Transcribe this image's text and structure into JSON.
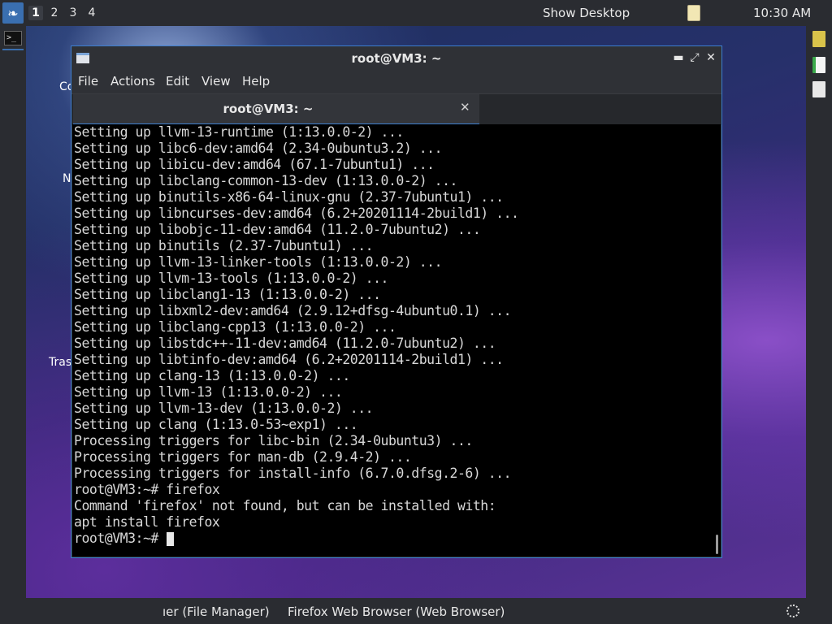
{
  "top_panel": {
    "workspaces": [
      "1",
      "2",
      "3",
      "4"
    ],
    "active_workspace": "1",
    "show_desktop": "Show Desktop",
    "clock": "10:30 AM",
    "menu_icon": "lxqt-menu-icon",
    "clipboard_icon": "clipboard-icon"
  },
  "left_panel": {
    "launcher_glyph": ">_"
  },
  "desktop": {
    "labels": [
      "Co",
      "N",
      "Tras"
    ]
  },
  "window": {
    "title": "root@VM3: ~",
    "controls": {
      "minimize": "▬",
      "maximize": "⤢",
      "close": "✕"
    },
    "menu": [
      "File",
      "Actions",
      "Edit",
      "View",
      "Help"
    ],
    "tab_label": "root@VM3: ~",
    "tab_close": "✕",
    "terminal_lines": [
      "Setting up llvm-13-runtime (1:13.0.0-2) ...",
      "Setting up libc6-dev:amd64 (2.34-0ubuntu3.2) ...",
      "Setting up libicu-dev:amd64 (67.1-7ubuntu1) ...",
      "Setting up libclang-common-13-dev (1:13.0.0-2) ...",
      "Setting up binutils-x86-64-linux-gnu (2.37-7ubuntu1) ...",
      "Setting up libncurses-dev:amd64 (6.2+20201114-2build1) ...",
      "Setting up libobjc-11-dev:amd64 (11.2.0-7ubuntu2) ...",
      "Setting up binutils (2.37-7ubuntu1) ...",
      "Setting up llvm-13-linker-tools (1:13.0.0-2) ...",
      "Setting up llvm-13-tools (1:13.0.0-2) ...",
      "Setting up libclang1-13 (1:13.0.0-2) ...",
      "Setting up libxml2-dev:amd64 (2.9.12+dfsg-4ubuntu0.1) ...",
      "Setting up libclang-cpp13 (1:13.0.0-2) ...",
      "Setting up libstdc++-11-dev:amd64 (11.2.0-7ubuntu2) ...",
      "Setting up libtinfo-dev:amd64 (6.2+20201114-2build1) ...",
      "Setting up clang-13 (1:13.0.0-2) ...",
      "Setting up llvm-13 (1:13.0.0-2) ...",
      "Setting up llvm-13-dev (1:13.0.0-2) ...",
      "Setting up clang (1:13.0-53~exp1) ...",
      "Processing triggers for libc-bin (2.34-0ubuntu3) ...",
      "Processing triggers for man-db (2.9.4-2) ...",
      "Processing triggers for install-info (6.7.0.dfsg.2-6) ...",
      "root@VM3:~# firefox",
      "Command 'firefox' not found, but can be installed with:",
      "apt install firefox"
    ],
    "prompt": "root@VM3:~# "
  },
  "right_panel": {
    "icons": [
      "qt-launcher-icon",
      "spreadsheet-icon",
      "formula-icon"
    ],
    "colors": [
      "#d9c34a",
      "#3aa84a",
      "#e8e8e8"
    ]
  },
  "bottom_panel": {
    "tasks": [
      "ıer (File Manager)",
      "Firefox Web Browser (Web Browser)"
    ],
    "tray_icon": "brightness-icon"
  }
}
